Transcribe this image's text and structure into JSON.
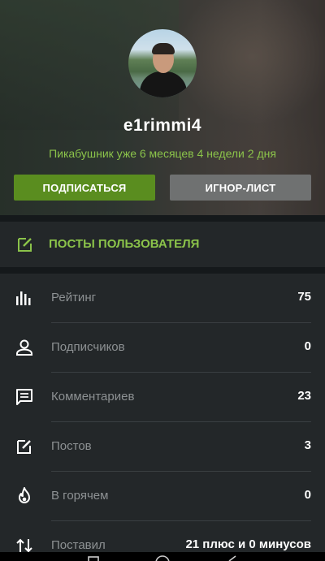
{
  "profile": {
    "username": "e1rimmi4",
    "tenure": "Пикабушник уже 6 месяцев 4 недели 2 дня",
    "subscribe_label": "ПОДПИСАТЬСЯ",
    "ignore_label": "ИГНОР-ЛИСТ"
  },
  "posts_link": {
    "label": "ПОСТЫ ПОЛЬЗОВАТЕЛЯ",
    "icon": "edit-icon"
  },
  "stats": [
    {
      "label": "Рейтинг",
      "value": "75",
      "icon": "rating-bars-icon"
    },
    {
      "label": "Подписчиков",
      "value": "0",
      "icon": "person-icon"
    },
    {
      "label": "Комментариев",
      "value": "23",
      "icon": "comment-icon"
    },
    {
      "label": "Постов",
      "value": "3",
      "icon": "edit-icon"
    },
    {
      "label": "В горячем",
      "value": "0",
      "icon": "fire-icon"
    },
    {
      "label": "Поставил",
      "value": "21 плюс и 0 минусов",
      "icon": "sort-arrows-icon"
    }
  ],
  "colors": {
    "accent_green": "#8bc34a",
    "subscribe_bg": "#5a8d1f",
    "ignore_bg": "#6f7171",
    "panel_bg": "#232729"
  }
}
